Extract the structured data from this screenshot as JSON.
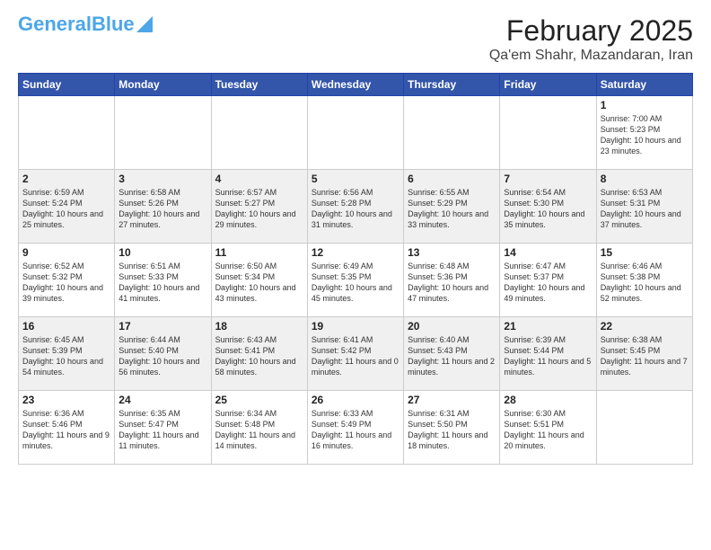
{
  "logo": {
    "text1": "General",
    "text2": "Blue"
  },
  "title": "February 2025",
  "location": "Qa'em Shahr, Mazandaran, Iran",
  "days_of_week": [
    "Sunday",
    "Monday",
    "Tuesday",
    "Wednesday",
    "Thursday",
    "Friday",
    "Saturday"
  ],
  "weeks": [
    [
      {
        "day": "",
        "sunrise": "",
        "sunset": "",
        "daylight": ""
      },
      {
        "day": "",
        "sunrise": "",
        "sunset": "",
        "daylight": ""
      },
      {
        "day": "",
        "sunrise": "",
        "sunset": "",
        "daylight": ""
      },
      {
        "day": "",
        "sunrise": "",
        "sunset": "",
        "daylight": ""
      },
      {
        "day": "",
        "sunrise": "",
        "sunset": "",
        "daylight": ""
      },
      {
        "day": "",
        "sunrise": "",
        "sunset": "",
        "daylight": ""
      },
      {
        "day": "1",
        "sunrise": "7:00 AM",
        "sunset": "5:23 PM",
        "daylight": "10 hours and 23 minutes."
      }
    ],
    [
      {
        "day": "2",
        "sunrise": "6:59 AM",
        "sunset": "5:24 PM",
        "daylight": "10 hours and 25 minutes."
      },
      {
        "day": "3",
        "sunrise": "6:58 AM",
        "sunset": "5:26 PM",
        "daylight": "10 hours and 27 minutes."
      },
      {
        "day": "4",
        "sunrise": "6:57 AM",
        "sunset": "5:27 PM",
        "daylight": "10 hours and 29 minutes."
      },
      {
        "day": "5",
        "sunrise": "6:56 AM",
        "sunset": "5:28 PM",
        "daylight": "10 hours and 31 minutes."
      },
      {
        "day": "6",
        "sunrise": "6:55 AM",
        "sunset": "5:29 PM",
        "daylight": "10 hours and 33 minutes."
      },
      {
        "day": "7",
        "sunrise": "6:54 AM",
        "sunset": "5:30 PM",
        "daylight": "10 hours and 35 minutes."
      },
      {
        "day": "8",
        "sunrise": "6:53 AM",
        "sunset": "5:31 PM",
        "daylight": "10 hours and 37 minutes."
      }
    ],
    [
      {
        "day": "9",
        "sunrise": "6:52 AM",
        "sunset": "5:32 PM",
        "daylight": "10 hours and 39 minutes."
      },
      {
        "day": "10",
        "sunrise": "6:51 AM",
        "sunset": "5:33 PM",
        "daylight": "10 hours and 41 minutes."
      },
      {
        "day": "11",
        "sunrise": "6:50 AM",
        "sunset": "5:34 PM",
        "daylight": "10 hours and 43 minutes."
      },
      {
        "day": "12",
        "sunrise": "6:49 AM",
        "sunset": "5:35 PM",
        "daylight": "10 hours and 45 minutes."
      },
      {
        "day": "13",
        "sunrise": "6:48 AM",
        "sunset": "5:36 PM",
        "daylight": "10 hours and 47 minutes."
      },
      {
        "day": "14",
        "sunrise": "6:47 AM",
        "sunset": "5:37 PM",
        "daylight": "10 hours and 49 minutes."
      },
      {
        "day": "15",
        "sunrise": "6:46 AM",
        "sunset": "5:38 PM",
        "daylight": "10 hours and 52 minutes."
      }
    ],
    [
      {
        "day": "16",
        "sunrise": "6:45 AM",
        "sunset": "5:39 PM",
        "daylight": "10 hours and 54 minutes."
      },
      {
        "day": "17",
        "sunrise": "6:44 AM",
        "sunset": "5:40 PM",
        "daylight": "10 hours and 56 minutes."
      },
      {
        "day": "18",
        "sunrise": "6:43 AM",
        "sunset": "5:41 PM",
        "daylight": "10 hours and 58 minutes."
      },
      {
        "day": "19",
        "sunrise": "6:41 AM",
        "sunset": "5:42 PM",
        "daylight": "11 hours and 0 minutes."
      },
      {
        "day": "20",
        "sunrise": "6:40 AM",
        "sunset": "5:43 PM",
        "daylight": "11 hours and 2 minutes."
      },
      {
        "day": "21",
        "sunrise": "6:39 AM",
        "sunset": "5:44 PM",
        "daylight": "11 hours and 5 minutes."
      },
      {
        "day": "22",
        "sunrise": "6:38 AM",
        "sunset": "5:45 PM",
        "daylight": "11 hours and 7 minutes."
      }
    ],
    [
      {
        "day": "23",
        "sunrise": "6:36 AM",
        "sunset": "5:46 PM",
        "daylight": "11 hours and 9 minutes."
      },
      {
        "day": "24",
        "sunrise": "6:35 AM",
        "sunset": "5:47 PM",
        "daylight": "11 hours and 11 minutes."
      },
      {
        "day": "25",
        "sunrise": "6:34 AM",
        "sunset": "5:48 PM",
        "daylight": "11 hours and 14 minutes."
      },
      {
        "day": "26",
        "sunrise": "6:33 AM",
        "sunset": "5:49 PM",
        "daylight": "11 hours and 16 minutes."
      },
      {
        "day": "27",
        "sunrise": "6:31 AM",
        "sunset": "5:50 PM",
        "daylight": "11 hours and 18 minutes."
      },
      {
        "day": "28",
        "sunrise": "6:30 AM",
        "sunset": "5:51 PM",
        "daylight": "11 hours and 20 minutes."
      },
      {
        "day": "",
        "sunrise": "",
        "sunset": "",
        "daylight": ""
      }
    ]
  ]
}
